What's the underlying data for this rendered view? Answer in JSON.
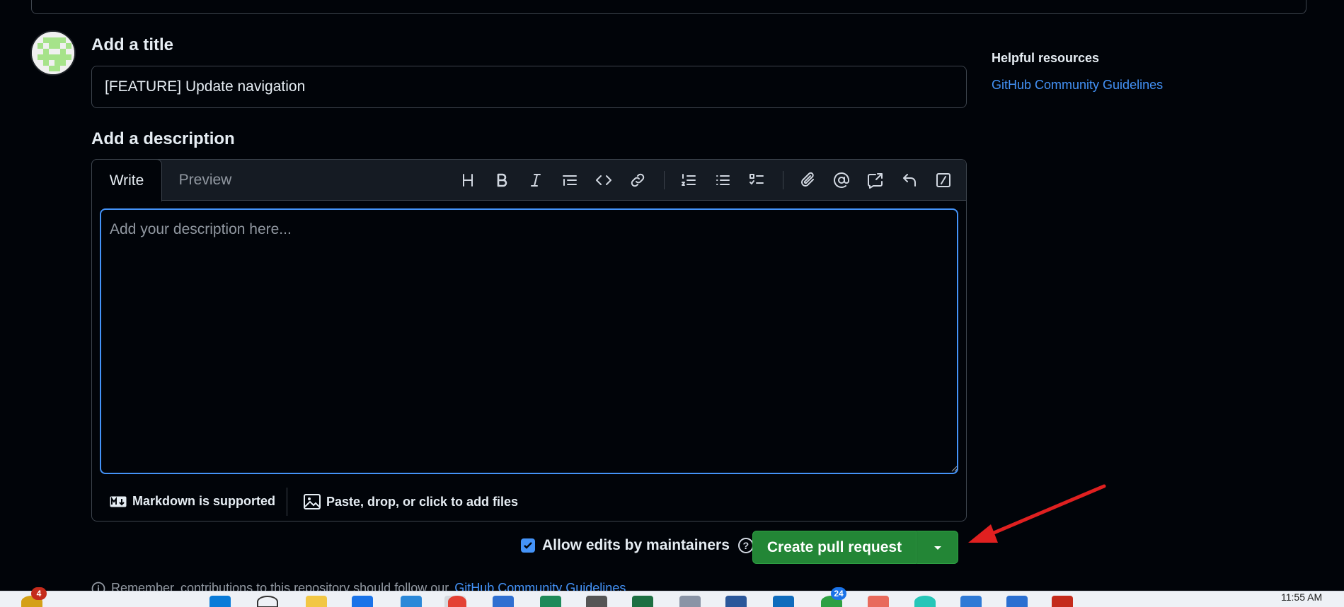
{
  "form": {
    "title_label": "Add a title",
    "title_value": "[FEATURE] Update navigation",
    "description_label": "Add a description"
  },
  "editor": {
    "tabs": [
      {
        "label": "Write",
        "active": true
      },
      {
        "label": "Preview",
        "active": false
      }
    ],
    "toolbar_icons": [
      "heading-icon",
      "bold-icon",
      "italic-icon",
      "quote-icon",
      "code-icon",
      "link-icon",
      "ordered-list-icon",
      "unordered-list-icon",
      "task-list-icon",
      "attach-icon",
      "mention-icon",
      "cross-reference-icon",
      "reply-icon",
      "slash-command-icon"
    ],
    "placeholder": "Add your description here...",
    "markdown_label": "Markdown is supported",
    "files_label": "Paste, drop, or click to add files"
  },
  "submit": {
    "allow_edits_label": "Allow edits by maintainers",
    "allow_edits_checked": true,
    "create_label": "Create pull request"
  },
  "remember": {
    "text": "Remember, contributions to this repository should follow our",
    "link": "GitHub Community Guidelines"
  },
  "sidebar": {
    "heading": "Helpful resources",
    "link": "GitHub Community Guidelines"
  },
  "taskbar": {
    "badge_left": "4",
    "badge_mid": "24",
    "time": "11:55 AM"
  },
  "colors": {
    "background": "#010409",
    "accent_blue": "#4493f8",
    "primary_green": "#238636",
    "annotation_red": "#e02020"
  }
}
